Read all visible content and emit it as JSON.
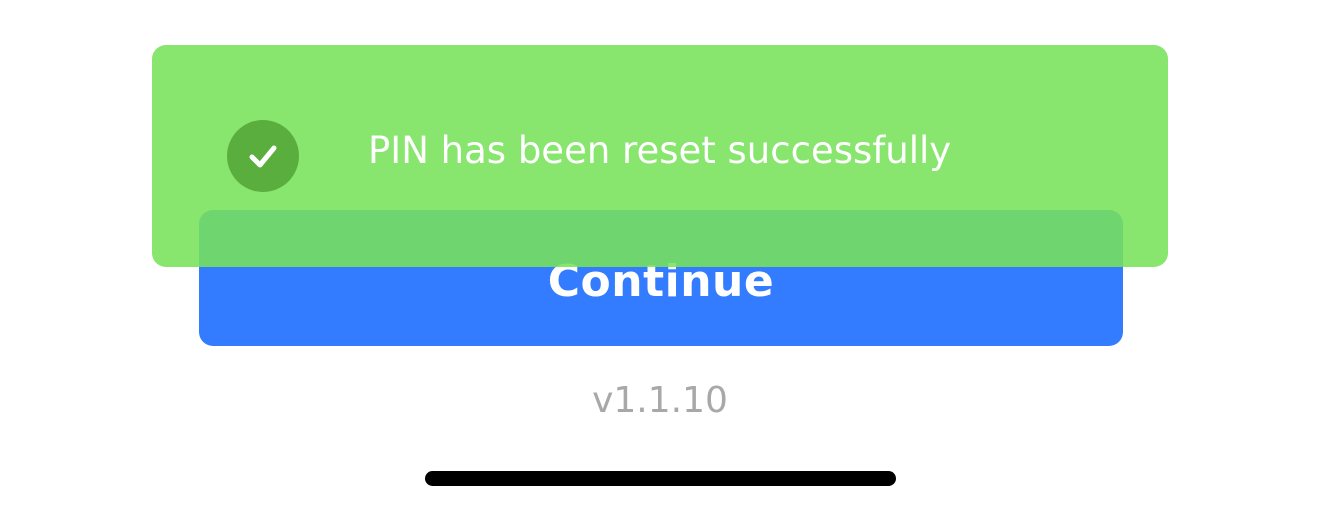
{
  "main": {
    "continue_label": "Continue",
    "version": "v1.1.10"
  },
  "toast": {
    "icon": "check-circle-icon",
    "message": "PIN has been reset successfully"
  },
  "colors": {
    "primary_button": "#337bff",
    "toast_background": "#78e15a",
    "toast_icon": "#5aae3e",
    "version_text": "#a8a8a8"
  }
}
